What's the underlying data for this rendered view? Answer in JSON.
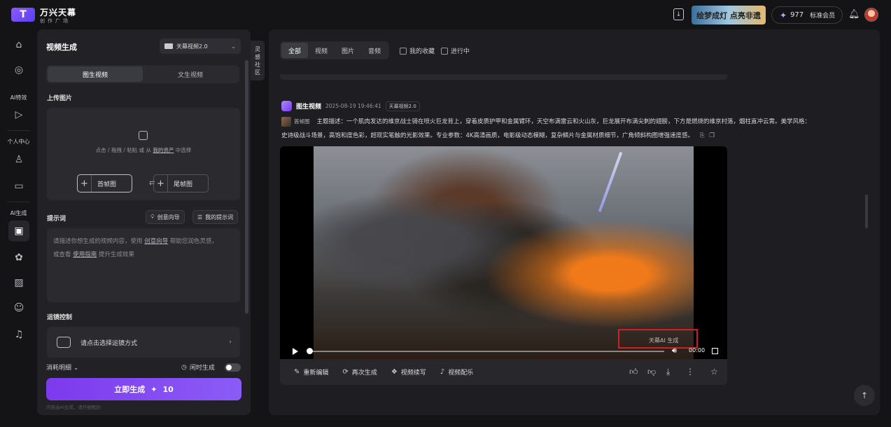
{
  "app": {
    "logo_char": "T",
    "title": "万兴天幕",
    "subtitle": "创作广场"
  },
  "topbar": {
    "banner_text": "绘梦成灯 点亮非遗",
    "credits": "977",
    "member": "标准会员"
  },
  "rail": {
    "labels": [
      "AI特效",
      "个人中心",
      "AI生成"
    ]
  },
  "form": {
    "title": "视频生成",
    "model": "天幕视频2.0",
    "tabs": [
      "图生视频",
      "文生视频"
    ],
    "upload_label": "上传图片",
    "upload_hint_pre": "点击 / 拖拽 / 粘贴 或 从 ",
    "upload_hint_link": "我的资产",
    "upload_hint_post": " 中选择",
    "first_frame": "首帧图",
    "last_frame": "尾帧图",
    "prompt_label": "提示词",
    "creative_btn": "创意向导",
    "my_prompts_btn": "我的提示词",
    "prompt_placeholder_1": "请描述你想生成的视频内容，使用 ",
    "prompt_placeholder_link1": "创意向导",
    "prompt_placeholder_2": " 帮助您润色灵感，",
    "prompt_placeholder_3": "或查看 ",
    "prompt_placeholder_link2": "使用指南",
    "prompt_placeholder_4": " 提升生成效果",
    "camera_label": "运镜控制",
    "camera_hint": "请点击选择运镜方式",
    "cost_label": "消耗明细",
    "idle_label": "闲时生成",
    "generate_label": "立即生成",
    "generate_cost": "10",
    "disclaimer": "内容由AI生成，请仔细甄别"
  },
  "community_tab": [
    "灵",
    "感",
    "社",
    "区"
  ],
  "results": {
    "filters": [
      "全部",
      "视频",
      "图片",
      "音频"
    ],
    "favorites_label": "我的收藏",
    "in_progress_label": "进行中",
    "card": {
      "type": "图生视频",
      "date": "2025-08-19 19:46:41",
      "model": "天幕视频2.0",
      "ref_tag": "首帧图",
      "description_1": "主题描述：一个肌肉发达的维京战士骑在喷火巨龙背上，穿着皮质护甲和金属臂环，天空布满雷云和火山灰，巨龙展开布满尖刺的翅膀，下方是燃烧的维京村落，烟柱直冲云霄。美学风格：",
      "description_2": "史诗级战斗场景，高饱和度色彩，超现实笔触的光影效果。专业参数：4K高清画质，电影级动态模糊，复杂鳞片与金属材质细节，广角倾斜构图增强速度感。",
      "watermark": "天幕AI 生成",
      "time": "00:00",
      "actions": [
        "重新编辑",
        "再次生成",
        "视频续写",
        "视频配乐"
      ]
    }
  }
}
